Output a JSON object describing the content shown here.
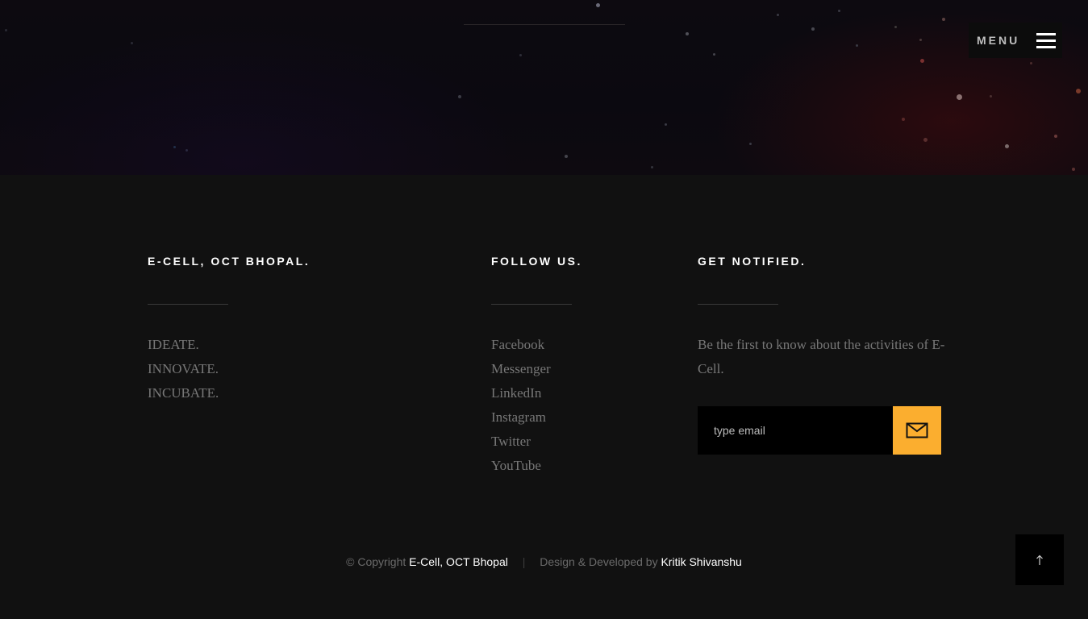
{
  "header": {
    "menu_label": "MENU",
    "menu_icon": "hamburger-icon"
  },
  "footer": {
    "about": {
      "title": "E-CELL, OCT BHOPAL.",
      "items": [
        "IDEATE.",
        "INNOVATE.",
        "INCUBATE."
      ]
    },
    "follow": {
      "title": "FOLLOW US.",
      "links": [
        "Facebook",
        "Messenger",
        "LinkedIn",
        "Instagram",
        "Twitter",
        "YouTube"
      ]
    },
    "notify": {
      "title": "GET NOTIFIED.",
      "text": "Be the first to know about the activities of E-Cell.",
      "email_placeholder": "type email",
      "submit_icon": "mail-icon"
    },
    "copyright": {
      "prefix": "© Copyright",
      "org": "E-Cell, OCT Bhopal",
      "separator": "|",
      "credit_prefix": "Design & Developed by",
      "author": "Kritik Shivanshu"
    },
    "back_to_top_icon": "arrow-up-icon"
  },
  "colors": {
    "accent": "#fbae2f",
    "footer_bg": "#111111",
    "muted_text": "#777777"
  }
}
